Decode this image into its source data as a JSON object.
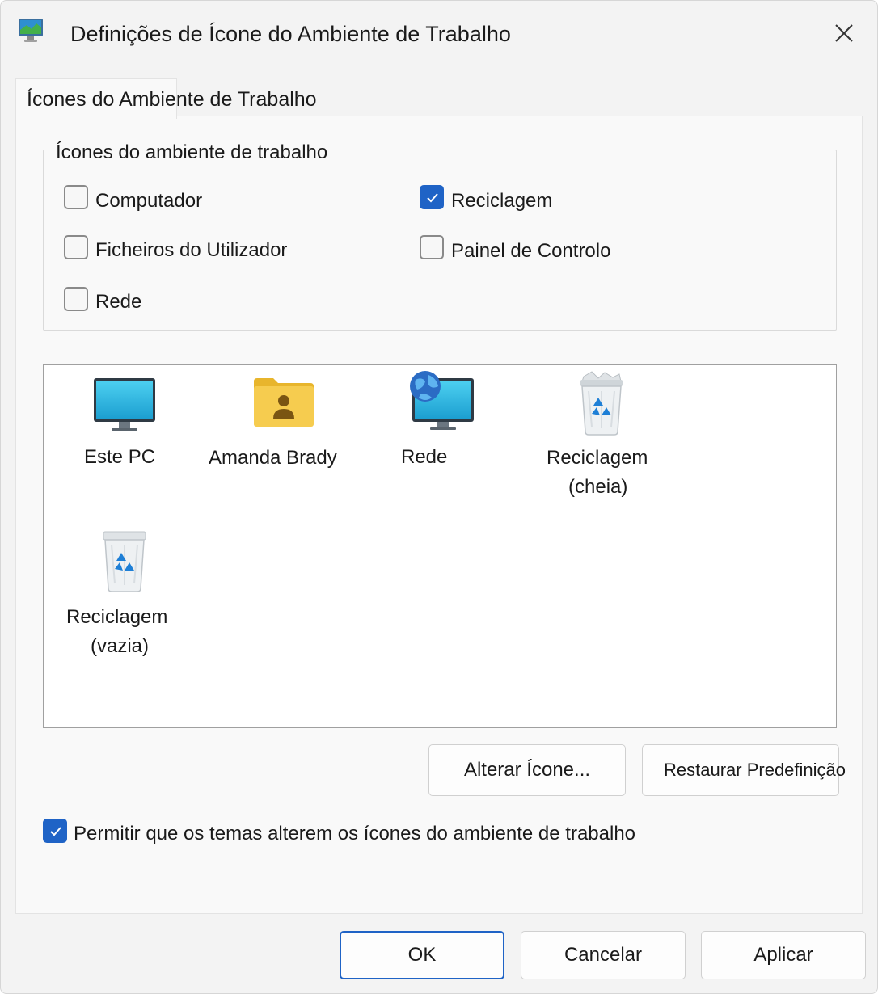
{
  "window": {
    "title": "Definições de Ícone do Ambiente de Trabalho",
    "icon": "desktop-settings-icon"
  },
  "tab": {
    "label": "Ícones do Ambiente de Trabalho"
  },
  "group": {
    "label": "Ícones do ambiente de trabalho",
    "checkboxes": [
      {
        "label": "Computador",
        "checked": false
      },
      {
        "label": "Reciclagem",
        "checked": true
      },
      {
        "label": "Ficheiros do Utilizador",
        "checked": false
      },
      {
        "label": "Painel de Controlo",
        "checked": false
      },
      {
        "label": "Rede",
        "checked": false
      }
    ]
  },
  "icons": [
    {
      "label": "Este PC",
      "icon": "monitor-icon"
    },
    {
      "label": "Amanda Brady",
      "icon": "user-folder-icon"
    },
    {
      "label": "Rede",
      "icon": "network-globe-icon"
    },
    {
      "label": "Reciclagem",
      "label2": "(cheia)",
      "icon": "recycle-bin-full-icon"
    },
    {
      "label": "Reciclagem",
      "label2": "(vazia)",
      "icon": "recycle-bin-empty-icon"
    }
  ],
  "buttons": {
    "change_icon": "Alterar Ícone...",
    "restore_default": "Restaurar Predefinição"
  },
  "allow_themes": {
    "label": "Permitir que os temas alterem os ícones do ambiente de trabalho",
    "checked": true
  },
  "footer": {
    "ok": "OK",
    "cancel": "Cancelar",
    "apply": "Aplicar"
  },
  "colors": {
    "accent": "#1f63c6",
    "window_bg": "#f3f3f3"
  }
}
